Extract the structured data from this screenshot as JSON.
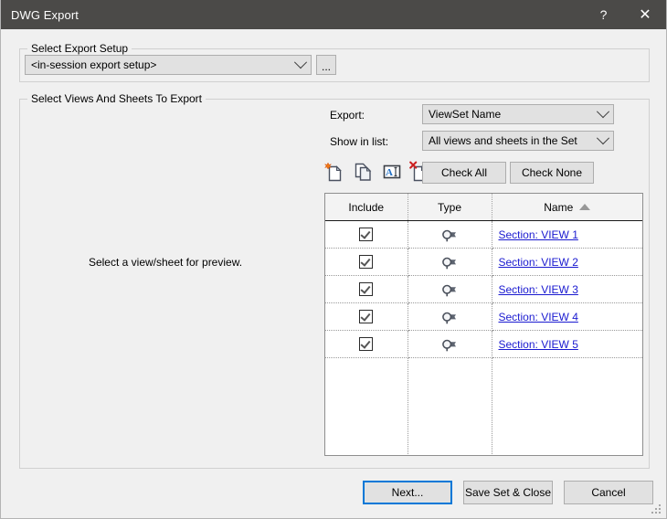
{
  "window": {
    "title": "DWG Export",
    "help_label": "?",
    "close_label": "✕"
  },
  "export_setup": {
    "group_label": "Select Export Setup",
    "combo_value": "<in-session export setup>",
    "browse_label": "..."
  },
  "views_group": {
    "group_label": "Select Views And Sheets To Export",
    "preview_placeholder": "Select a view/sheet for preview."
  },
  "filters": {
    "export_label": "Export:",
    "export_value": "ViewSet Name",
    "show_in_list_label": "Show in list:",
    "show_in_list_value": "All views and sheets in the Set"
  },
  "toolbar": {
    "icons": [
      {
        "name": "new-set-icon",
        "tip": "New Set"
      },
      {
        "name": "duplicate-set-icon",
        "tip": "Duplicate Set"
      },
      {
        "name": "rename-set-icon",
        "tip": "Rename Set"
      },
      {
        "name": "delete-set-icon",
        "tip": "Delete Set"
      }
    ],
    "check_all_label": "Check All",
    "check_none_label": "Check None"
  },
  "table": {
    "columns": [
      {
        "key": "include",
        "label": "Include",
        "sorted": false
      },
      {
        "key": "type",
        "label": "Type",
        "sorted": false
      },
      {
        "key": "name",
        "label": "Name",
        "sorted": true,
        "sort_dir": "asc"
      }
    ],
    "rows": [
      {
        "include": true,
        "type_icon": "section-marker-icon",
        "name": "Section: VIEW 1"
      },
      {
        "include": true,
        "type_icon": "section-marker-icon",
        "name": "Section: VIEW 2"
      },
      {
        "include": true,
        "type_icon": "section-marker-icon",
        "name": "Section: VIEW 3"
      },
      {
        "include": true,
        "type_icon": "section-marker-icon",
        "name": "Section: VIEW 4"
      },
      {
        "include": true,
        "type_icon": "section-marker-icon",
        "name": "Section: VIEW 5"
      }
    ]
  },
  "footer": {
    "next_label": "Next...",
    "save_label": "Save Set & Close",
    "cancel_label": "Cancel"
  },
  "colors": {
    "titlebar": "#4b4a48",
    "dialog_bg": "#f0f0f0",
    "accent_focus": "#0078d7",
    "link": "#1a1ad0",
    "button_face": "#e1e1e1"
  }
}
